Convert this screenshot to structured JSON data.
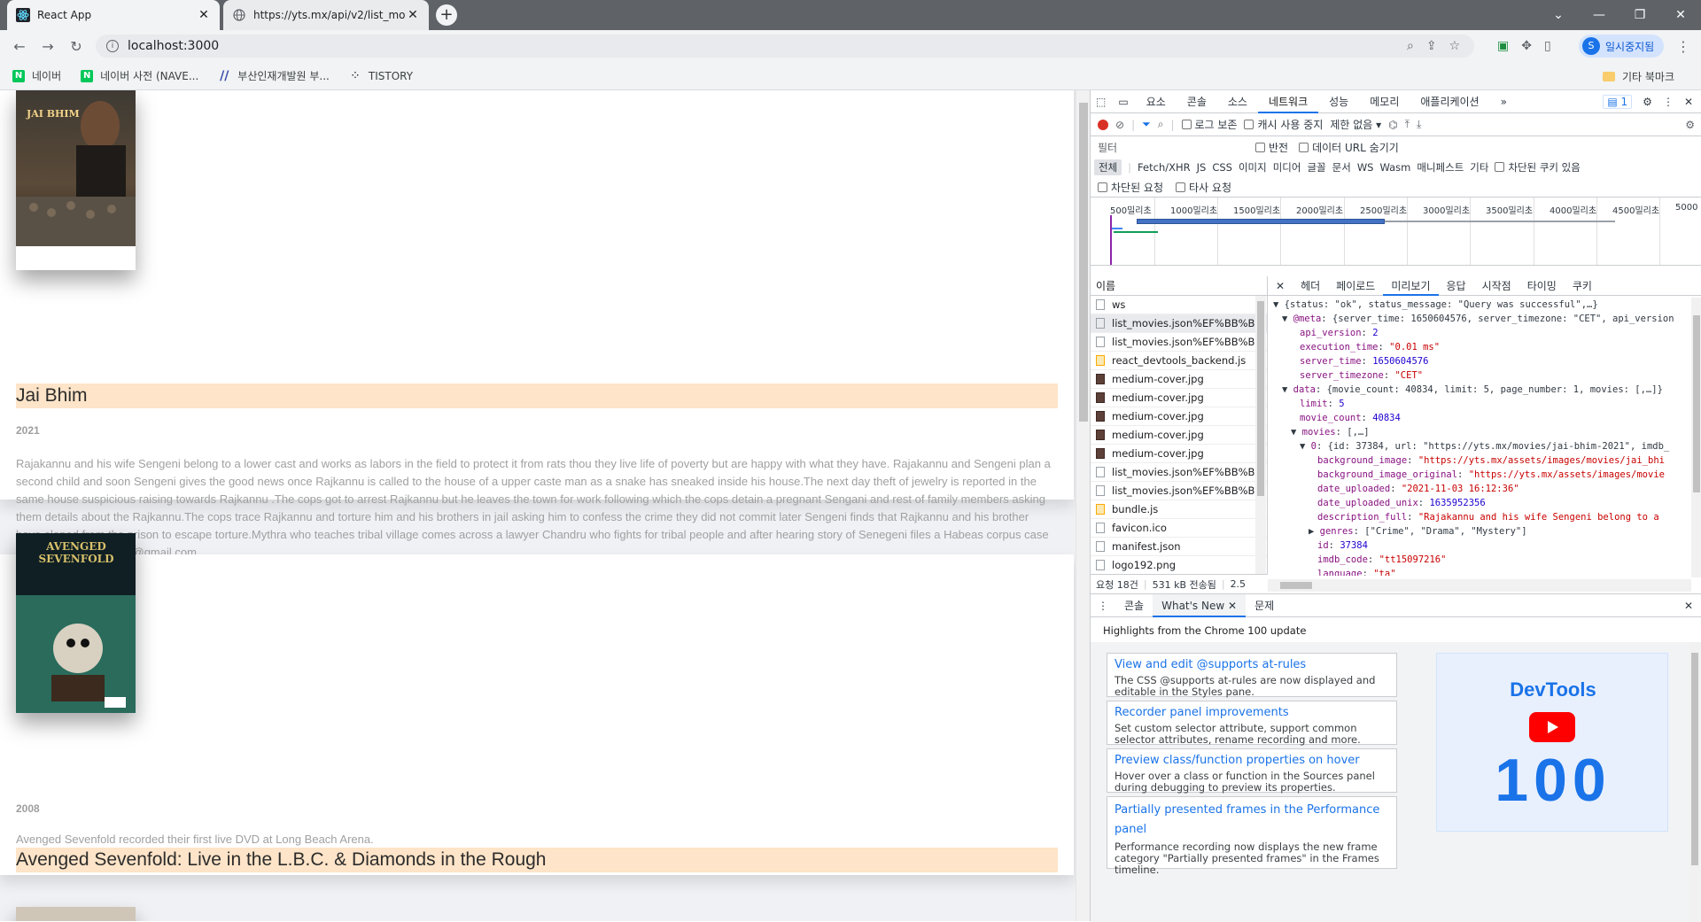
{
  "browser": {
    "tabs": [
      {
        "title": "React App"
      },
      {
        "title": "https://yts.mx/api/v2/list_movie"
      }
    ],
    "address": "localhost:3000",
    "profile_label": "일시중지됨",
    "profile_initial": "S",
    "bookmarks": [
      {
        "label": "네이버",
        "icon": "naver-icon"
      },
      {
        "label": "네이버 사전 (NAVE...",
        "icon": "naver-dict-icon"
      },
      {
        "label": "부산인재개발원 부...",
        "icon": "slash-icon"
      },
      {
        "label": "TISTORY",
        "icon": "tistory-icon"
      }
    ],
    "other_bookmarks": "기타 북마크"
  },
  "movies": [
    {
      "title": "Jai Bhim",
      "year": "2021",
      "description": "Rajakannu and his wife Sengeni belong to a lower cast and works as labors in the field to protect it from rats thou they live life of poverty but are happy with what they have. Rajakannu and Sengeni plan a second child and soon Sengeni gives the good news once Rajkannu is called to the house of a upper caste man as a snake has sneaked inside his house.The next day theft of jewelry is reported in the same house suspicious raising towards Rajkannu .The cops got to arrest Rajkannu but he leaves the town for work following which the cops detain a pregnant Sengani and rest of family members asking them details about the Rajkannu.The cops trace Rajkannu and torture him and his brothers in jail asking him to confess the crime they did not commit later Sengeni finds that Rajkannu and his brother have eloped from the prison to escape torture.Mythra who teaches tribal village comes across a lawyer Chandru who fights for tribal people and after hearing story of Senegeni files a Habeas corpus case in court. —alex.mjacko@gmail.com",
      "poster_title": "JAI BHIM"
    },
    {
      "title": "Avenged Sevenfold: Live in the L.B.C. & Diamonds in the Rough",
      "year": "2008",
      "description": "Avenged Sevenfold recorded their first live DVD at Long Beach Arena.",
      "poster_title": "AVENGED SEVENFOLD"
    }
  ],
  "devtools": {
    "tabs": [
      "요소",
      "콘솔",
      "소스",
      "네트워크",
      "성능",
      "메모리",
      "애플리케이션"
    ],
    "selected_tab": "네트워크",
    "issues_count": "1",
    "netbar": {
      "preserve_log": "로그 보존",
      "disable_cache": "캐시 사용 중지",
      "throttle": "제한 없음"
    },
    "filter": {
      "label": "필터",
      "invert": "반전",
      "hide_data_urls": "데이터 URL 숨기기"
    },
    "types": [
      "전체",
      "Fetch/XHR",
      "JS",
      "CSS",
      "이미지",
      "미디어",
      "글꼴",
      "문서",
      "WS",
      "Wasm",
      "매니페스트",
      "기타"
    ],
    "blocked_cookies": "차단된 쿠키 있음",
    "blocked_requests": "차단된 요청",
    "third_party": "타사 요청",
    "ticks": [
      "500밀리초",
      "1000밀리초",
      "1500밀리초",
      "2000밀리초",
      "2500밀리초",
      "3000밀리초",
      "3500밀리초",
      "4000밀리초",
      "4500밀리초",
      "5000"
    ],
    "name_header": "이름",
    "requests": [
      {
        "name": "ws",
        "kind": "doc"
      },
      {
        "name": "list_movies.json%EF%BB%BF?",
        "kind": "doc"
      },
      {
        "name": "list_movies.json%EF%BB%BF?",
        "kind": "doc"
      },
      {
        "name": "react_devtools_backend.js",
        "kind": "js"
      },
      {
        "name": "medium-cover.jpg",
        "kind": "img"
      },
      {
        "name": "medium-cover.jpg",
        "kind": "img"
      },
      {
        "name": "medium-cover.jpg",
        "kind": "img"
      },
      {
        "name": "medium-cover.jpg",
        "kind": "img"
      },
      {
        "name": "medium-cover.jpg",
        "kind": "img"
      },
      {
        "name": "list_movies.json%EF%BB%BF?",
        "kind": "doc"
      },
      {
        "name": "list_movies.json%EF%BB%BF?",
        "kind": "doc"
      },
      {
        "name": "bundle.js",
        "kind": "js"
      },
      {
        "name": "favicon.ico",
        "kind": "doc"
      },
      {
        "name": "manifest.json",
        "kind": "doc"
      },
      {
        "name": "logo192.png",
        "kind": "doc"
      }
    ],
    "status": {
      "requests": "요청 18건",
      "transferred": "531 kB 전송됨",
      "extra": "2.5"
    },
    "detail_tabs": [
      "헤더",
      "페이로드",
      "미리보기",
      "응답",
      "시작점",
      "타이밍",
      "쿠키"
    ],
    "detail_selected": "미리보기",
    "preview": [
      {
        "indent": 0,
        "arrow": "▼",
        "text": "{status: \"ok\", status_message: \"Query was successful\",…}"
      },
      {
        "indent": 1,
        "arrow": "▼",
        "key": "@meta",
        "text": "{server_time: 1650604576, server_timezone: \"CET\", api_version"
      },
      {
        "indent": 2,
        "key": "api_version",
        "num": "2"
      },
      {
        "indent": 2,
        "key": "execution_time",
        "str": "\"0.01 ms\""
      },
      {
        "indent": 2,
        "key": "server_time",
        "num": "1650604576"
      },
      {
        "indent": 2,
        "key": "server_timezone",
        "str": "\"CET\""
      },
      {
        "indent": 1,
        "arrow": "▼",
        "key": "data",
        "text": "{movie_count: 40834, limit: 5, page_number: 1, movies: [,…]}"
      },
      {
        "indent": 2,
        "key": "limit",
        "num": "5"
      },
      {
        "indent": 2,
        "key": "movie_count",
        "num": "40834"
      },
      {
        "indent": 2,
        "arrow": "▼",
        "key": "movies",
        "text": "[,…]"
      },
      {
        "indent": 3,
        "arrow": "▼",
        "key": "0",
        "text": "{id: 37384, url: \"https://yts.mx/movies/jai-bhim-2021\", imdb_"
      },
      {
        "indent": 4,
        "key": "background_image",
        "str": "\"https://yts.mx/assets/images/movies/jai_bhi"
      },
      {
        "indent": 4,
        "key": "background_image_original",
        "str": "\"https://yts.mx/assets/images/movie"
      },
      {
        "indent": 4,
        "key": "date_uploaded",
        "str": "\"2021-11-03 16:12:36\""
      },
      {
        "indent": 4,
        "key": "date_uploaded_unix",
        "num": "1635952356"
      },
      {
        "indent": 4,
        "key": "description_full",
        "str": "\"Rajakannu and his wife Sengeni belong to a"
      },
      {
        "indent": 4,
        "arrow": "▶",
        "key": "genres",
        "text": "[\"Crime\", \"Drama\", \"Mystery\"]"
      },
      {
        "indent": 4,
        "key": "id",
        "num": "37384"
      },
      {
        "indent": 4,
        "key": "imdb_code",
        "str": "\"tt15097216\""
      },
      {
        "indent": 4,
        "key": "language",
        "str": "\"ta\""
      }
    ],
    "drawer": {
      "tabs": [
        "콘솔",
        "What's New",
        "문제"
      ],
      "selected": "What's New",
      "highlight": "Highlights from the Chrome 100 update",
      "cards": [
        {
          "title": "View and edit @supports at-rules",
          "desc": "The CSS @supports at-rules are now displayed and editable in the Styles pane."
        },
        {
          "title": "Recorder panel improvements",
          "desc": "Set custom selector attribute, support common selector attributes, rename recording and more."
        },
        {
          "title": "Preview class/function properties on hover",
          "desc": "Hover over a class or function in the Sources panel during debugging to preview its properties."
        },
        {
          "title": "Partially presented frames in the Performance panel",
          "desc": "Performance recording now displays the new frame category \"Partially presented frames\" in the Frames timeline."
        }
      ],
      "promo_title": "DevTools",
      "promo_number": "100"
    }
  },
  "colors": {
    "accent": "#1a73e8",
    "title_highlight": "#fee4c8",
    "record": "#d93025"
  }
}
